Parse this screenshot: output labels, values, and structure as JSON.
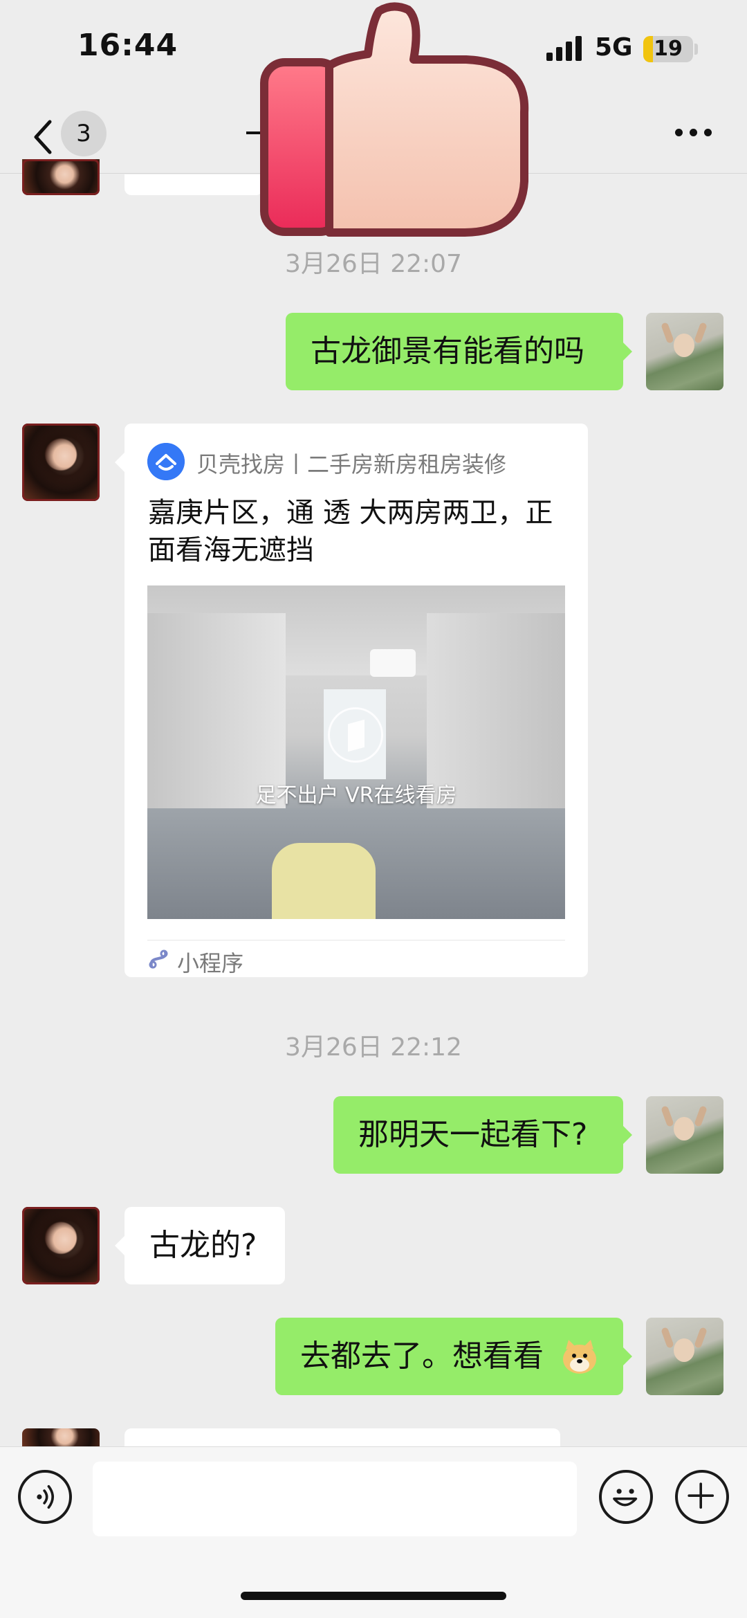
{
  "status_bar": {
    "time": "16:44",
    "network": "5G",
    "battery": "19"
  },
  "nav": {
    "unread_count": "3",
    "back_icon": "chevron-left-icon",
    "more_icon": "more-icon"
  },
  "overlay_sticker": "thumbs-up-sticker",
  "messages": [
    {
      "type": "timestamp",
      "text": "3月26日 22:07"
    },
    {
      "type": "text",
      "from": "self",
      "text": "古龙御景有能看的吗"
    },
    {
      "type": "mini_program",
      "from": "other",
      "source": "贝壳找房丨二手房新房租房装修",
      "title": "嘉庚片区，通 透 大两房两卫，正面看海无遮挡",
      "image_caption": "足不出户 VR在线看房",
      "footer": "小程序"
    },
    {
      "type": "timestamp",
      "text": "3月26日 22:12"
    },
    {
      "type": "text",
      "from": "self",
      "text": "那明天一起看下?"
    },
    {
      "type": "text",
      "from": "other",
      "text": "古龙的?"
    },
    {
      "type": "text",
      "from": "self",
      "text": "去都去了。想看看",
      "emoji": "doge-emoji"
    }
  ],
  "input_bar": {
    "placeholder": "",
    "voice_icon": "voice-icon",
    "emoji_icon": "smile-icon",
    "plus_icon": "plus-icon"
  },
  "colors": {
    "background": "#ededed",
    "self_bubble": "#95ec69",
    "other_bubble": "#ffffff",
    "timestamp": "#a9a9a9",
    "mini_program_logo": "#3478f6"
  }
}
